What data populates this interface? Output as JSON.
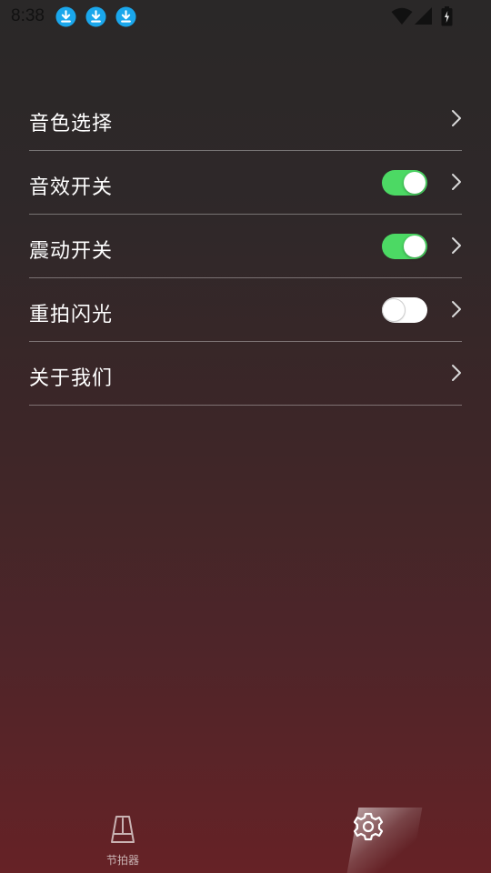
{
  "status_bar": {
    "time": "8:38",
    "notification_icons": [
      "download-icon",
      "download-icon",
      "download-icon"
    ],
    "system_icons": [
      "wifi-icon",
      "cellular-signal-icon",
      "battery-charging-icon"
    ]
  },
  "settings": {
    "items": [
      {
        "label": "音色选择",
        "has_toggle": false
      },
      {
        "label": "音效开关",
        "has_toggle": true,
        "toggle_on": true
      },
      {
        "label": "震动开关",
        "has_toggle": true,
        "toggle_on": true
      },
      {
        "label": "重拍闪光",
        "has_toggle": true,
        "toggle_on": false
      },
      {
        "label": "关于我们",
        "has_toggle": false
      }
    ]
  },
  "tab_bar": {
    "tabs": [
      {
        "label": "节拍器",
        "icon": "metronome-icon",
        "active": false
      },
      {
        "label": "",
        "icon": "gear-icon",
        "active": true
      }
    ]
  },
  "colors": {
    "toggle_on": "#4cd964",
    "background_top": "#2a2828",
    "background_bottom": "#662226"
  }
}
